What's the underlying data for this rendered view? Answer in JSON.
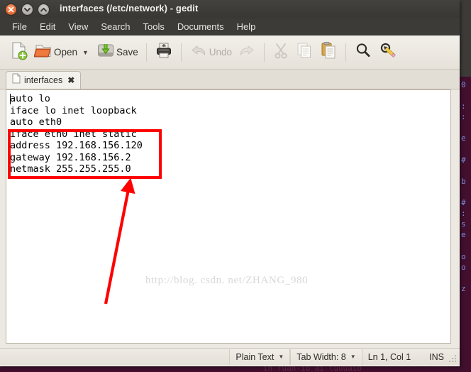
{
  "window": {
    "title": "interfaces (/etc/network) - gedit",
    "controls": [
      {
        "name": "close",
        "glyph": "×"
      },
      {
        "name": "minimize",
        "glyph": "⌄"
      },
      {
        "name": "maximize",
        "glyph": "⌃"
      }
    ]
  },
  "menubar": {
    "items": [
      {
        "label": "File"
      },
      {
        "label": "Edit"
      },
      {
        "label": "View"
      },
      {
        "label": "Search"
      },
      {
        "label": "Tools"
      },
      {
        "label": "Documents"
      },
      {
        "label": "Help"
      }
    ]
  },
  "toolbar": {
    "new_icon": "new-document-icon",
    "open_label": "Open",
    "open_icon": "open-folder-icon",
    "open_dropdown": "▼",
    "save_label": "Save",
    "save_icon": "save-disk-icon",
    "print_icon": "printer-icon",
    "undo_label": "Undo",
    "undo_icon": "undo-arrow-icon",
    "redo_icon": "redo-arrow-icon",
    "cut_icon": "scissors-icon",
    "copy_icon": "copy-pages-icon",
    "paste_icon": "clipboard-icon",
    "find_icon": "magnifier-icon",
    "replace_icon": "magnifier-pencil-icon"
  },
  "tabs": [
    {
      "label": "interfaces",
      "icon": "document-icon",
      "close": "✖"
    }
  ],
  "editor": {
    "content": "auto lo\niface lo inet loopback\nauto eth0\niface eth0 inet static\naddress 192.168.156.120\ngateway 192.168.156.2\nnetmask 255.255.255.0",
    "lines": [
      "auto lo",
      "iface lo inet loopback",
      "auto eth0",
      "iface eth0 inet static",
      "address 192.168.156.120",
      "gateway 192.168.156.2",
      "netmask 255.255.255.0"
    ]
  },
  "watermark": {
    "text": "http://blog. csdn. net/ZHANG_980"
  },
  "statusbar": {
    "language": "Plain Text",
    "language_caret": "▼",
    "tab_width": "Tab Width: 8",
    "tab_width_caret": "▼",
    "position": "Ln 1, Col 1",
    "insert_mode": "INS"
  },
  "annotations": {
    "box": {
      "color": "#ff0000",
      "covers_lines": [
        "iface eth0 inet static",
        "address 192.168.156.120",
        "gateway 192.168.156.2",
        "netmask 255.255.255.0"
      ]
    },
    "arrow": {
      "color": "#ff0000",
      "from": "149,428",
      "to": "181,256"
    }
  },
  "background": {
    "terminal_right_column": "0\n\n:\n:\n\ne\n\n#\n\nb\n\n#\n:\ns\ne\n\no\no\n\nz",
    "terminal_bottom_line": "                                                        ih ruah-ib ai tuuuaib"
  },
  "colors": {
    "titlebar": "#3c3b37",
    "toolbar": "#ece9e2",
    "accent_close": "#e8703a",
    "annotation": "#ff0000",
    "desktop": "#420f2e"
  }
}
